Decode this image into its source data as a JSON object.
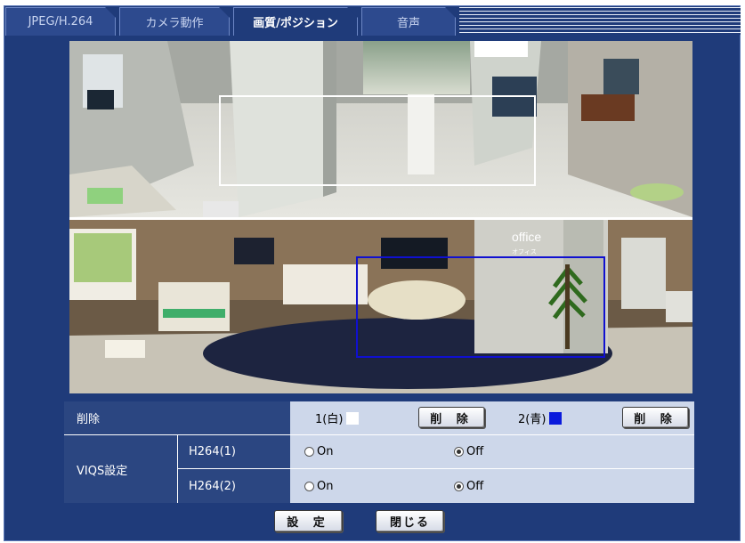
{
  "tabs": [
    {
      "label": "JPEG/H.264",
      "active": false
    },
    {
      "label": "カメラ動作",
      "active": false
    },
    {
      "label": "画質/ポジション",
      "active": true
    },
    {
      "label": "音声",
      "active": false
    }
  ],
  "views": {
    "top": {
      "box_color": "#ffffff"
    },
    "bottom": {
      "box_color": "#1010d0",
      "sign_text": "office",
      "sign_sub": "オフィス"
    }
  },
  "delete_row": {
    "label": "削除",
    "area1_label": "1(白)",
    "area1_color": "#ffffff",
    "area1_button": "削 除",
    "area2_label": "2(青)",
    "area2_color": "#0a1adc",
    "area2_button": "削 除"
  },
  "viqs": {
    "label": "VIQS設定",
    "rows": [
      {
        "name": "H264(1)",
        "on_label": "On",
        "off_label": "Off",
        "selected": "Off"
      },
      {
        "name": "H264(2)",
        "on_label": "On",
        "off_label": "Off",
        "selected": "Off"
      }
    ]
  },
  "footer": {
    "set_button": "設 定",
    "close_button": "閉じる"
  }
}
